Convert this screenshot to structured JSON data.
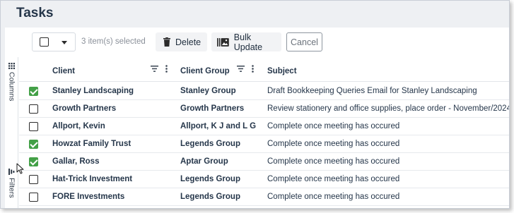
{
  "page": {
    "title": "Tasks"
  },
  "toolbar": {
    "selected_count": "3 item(s) selected",
    "delete_label": "Delete",
    "bulk_update_label": "Bulk Update",
    "cancel_label": "Cancel"
  },
  "sidebar": {
    "columns_label": "Columns",
    "filters_label": "Filters"
  },
  "grid": {
    "columns": [
      "Client",
      "Client Group",
      "Subject"
    ],
    "rows": [
      {
        "checked": true,
        "client": "Stanley Landscaping",
        "group": "Stanley Group",
        "subject": "Draft Bookkeeping Queries Email for Stanley Landscaping"
      },
      {
        "checked": false,
        "client": "Growth Partners",
        "group": "Growth Partners",
        "subject": "Review stationery and office supplies, place order - November/2024"
      },
      {
        "checked": false,
        "client": "Allport, Kevin",
        "group": "Allport, K J and L G",
        "subject": "Complete once meeting has occured"
      },
      {
        "checked": true,
        "client": "Howzat Family Trust",
        "group": "Legends Group",
        "subject": "Complete once meeting has occured"
      },
      {
        "checked": true,
        "client": "Gallar, Ross",
        "group": "Aptar Group",
        "subject": "Complete once meeting has occured"
      },
      {
        "checked": false,
        "client": "Hat-Trick Investment",
        "group": "Legends Group",
        "subject": "Complete once meeting has occured"
      },
      {
        "checked": false,
        "client": "FORE Investments",
        "group": "Legends Group",
        "subject": "Complete once meeting has occured"
      }
    ]
  },
  "colors": {
    "accent_check": "#43a047",
    "text_dark": "#25364a",
    "header_bg": "#eef0f3"
  },
  "icons": [
    "caret-down-icon",
    "trash-icon",
    "bulk-update-icon",
    "columns-icon",
    "filters-icon",
    "filter-icon",
    "more-vertical-icon",
    "pointer-cursor-icon"
  ]
}
